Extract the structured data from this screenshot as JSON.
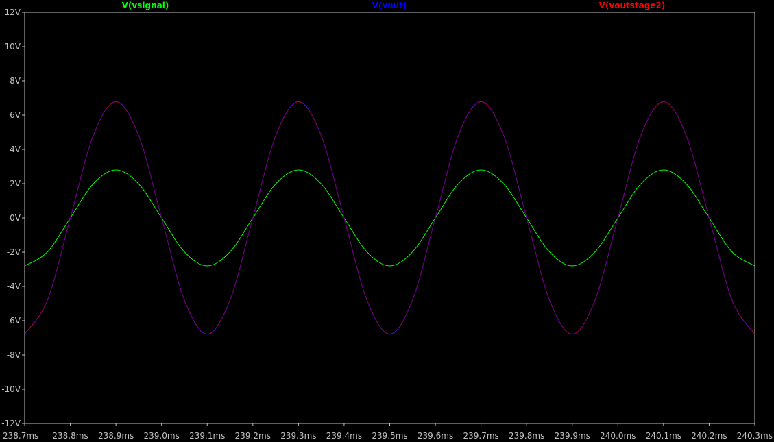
{
  "colors": {
    "background": "#000000",
    "frame": "#bfbfbf",
    "tick_text": "#c0c0c0"
  },
  "chart_data": {
    "type": "line",
    "x_unit": "ms",
    "y_unit": "V",
    "xlim": [
      238.7,
      240.3
    ],
    "ylim": [
      -12,
      12
    ],
    "grid": false,
    "legend_position": "top",
    "x_ticks": [
      "238.7ms",
      "238.8ms",
      "238.9ms",
      "239.0ms",
      "239.1ms",
      "239.2ms",
      "239.3ms",
      "239.4ms",
      "239.5ms",
      "239.6ms",
      "239.7ms",
      "239.8ms",
      "239.9ms",
      "240.0ms",
      "240.1ms",
      "240.2ms",
      "240.3ms"
    ],
    "x_tick_values": [
      238.7,
      238.8,
      238.9,
      239.0,
      239.1,
      239.2,
      239.3,
      239.4,
      239.5,
      239.6,
      239.7,
      239.8,
      239.9,
      240.0,
      240.1,
      240.2,
      240.3
    ],
    "y_ticks": [
      "12V",
      "10V",
      "8V",
      "6V",
      "4V",
      "2V",
      "0V",
      "-2V",
      "-4V",
      "-6V",
      "-8V",
      "-10V",
      "-12V"
    ],
    "y_tick_values": [
      12,
      10,
      8,
      6,
      4,
      2,
      0,
      -2,
      -4,
      -6,
      -8,
      -10,
      -12
    ],
    "series": [
      {
        "name": "V(vsignal)",
        "color": "#00ff00",
        "x": [
          238.7,
          238.75,
          238.8,
          238.85,
          238.9,
          238.95,
          239.0,
          239.05,
          239.1,
          239.15,
          239.2,
          239.25,
          239.3,
          239.35,
          239.4,
          239.45,
          239.5,
          239.55,
          239.6,
          239.65,
          239.7,
          239.75,
          239.8,
          239.85,
          239.9,
          239.95,
          240.0,
          240.05,
          240.1,
          240.15,
          240.2,
          240.25,
          240.3
        ],
        "y": [
          -2.8,
          -1.98,
          0,
          1.98,
          2.8,
          1.98,
          0,
          -1.98,
          -2.8,
          -1.98,
          0,
          1.98,
          2.8,
          1.98,
          0,
          -1.98,
          -2.8,
          -1.98,
          0,
          1.98,
          2.8,
          1.98,
          0,
          -1.98,
          -2.8,
          -1.98,
          0,
          1.98,
          2.8,
          1.98,
          0,
          -1.98,
          -2.8
        ]
      },
      {
        "name": "V(vout)",
        "color": "#0000ff",
        "x": [
          238.7,
          238.75,
          238.8,
          238.85,
          238.9,
          238.95,
          239.0,
          239.05,
          239.1,
          239.15,
          239.2,
          239.25,
          239.3,
          239.35,
          239.4,
          239.45,
          239.5,
          239.55,
          239.6,
          239.65,
          239.7,
          239.75,
          239.8,
          239.85,
          239.9,
          239.95,
          240.0,
          240.05,
          240.1,
          240.15,
          240.2,
          240.25,
          240.3
        ],
        "y": [
          -6.8,
          -4.81,
          0,
          4.81,
          6.8,
          4.81,
          0,
          -4.81,
          -6.8,
          -4.81,
          0,
          4.81,
          6.8,
          4.81,
          0,
          -4.81,
          -6.8,
          -4.81,
          0,
          4.81,
          6.8,
          4.81,
          0,
          -4.81,
          -6.8,
          -4.81,
          0,
          4.81,
          6.8,
          4.81,
          0,
          -4.81,
          -6.8
        ]
      },
      {
        "name": "V(voutstage2)",
        "color": "#ff0000",
        "x": [
          238.7,
          238.75,
          238.8,
          238.85,
          238.9,
          238.95,
          239.0,
          239.05,
          239.1,
          239.15,
          239.2,
          239.25,
          239.3,
          239.35,
          239.4,
          239.45,
          239.5,
          239.55,
          239.6,
          239.65,
          239.7,
          239.75,
          239.8,
          239.85,
          239.9,
          239.95,
          240.0,
          240.05,
          240.1,
          240.15,
          240.2,
          240.25,
          240.3
        ],
        "y": [
          -6.78,
          -4.79,
          0,
          4.79,
          6.78,
          4.79,
          0,
          -4.79,
          -6.78,
          -4.79,
          0,
          4.79,
          6.78,
          4.79,
          0,
          -4.79,
          -6.78,
          -4.79,
          0,
          4.79,
          6.78,
          4.79,
          0,
          -4.79,
          -6.78,
          -4.79,
          0,
          4.79,
          6.78,
          4.79,
          0,
          -4.79,
          -6.78
        ]
      }
    ]
  }
}
